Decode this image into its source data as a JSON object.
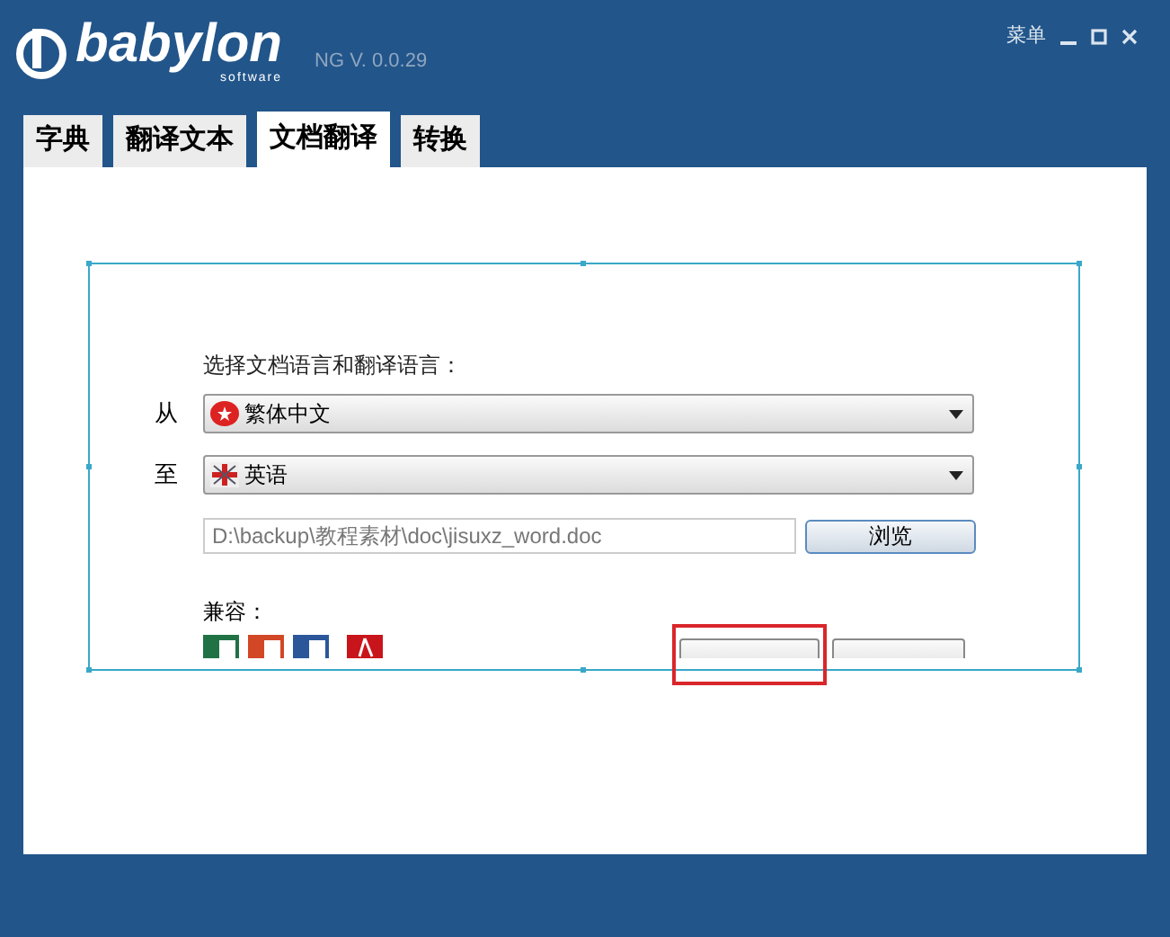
{
  "window": {
    "logo": "babylon",
    "logo_sub": "software",
    "version": "NG V. 0.0.29",
    "menu": "菜单"
  },
  "tabs": [
    {
      "label": "字典",
      "selected": false
    },
    {
      "label": "翻译文本",
      "selected": false
    },
    {
      "label": "文档翻译",
      "selected": true
    },
    {
      "label": "转换",
      "selected": false
    }
  ],
  "form": {
    "prompt": "选择文档语言和翻译语言：",
    "from": {
      "label": "从",
      "value": "繁体中文"
    },
    "to": {
      "label": "至",
      "value": "英语"
    },
    "file_path": "D:\\backup\\教程素材\\doc\\jisuxz_word.doc",
    "browse": "浏览",
    "compatible": "兼容："
  }
}
